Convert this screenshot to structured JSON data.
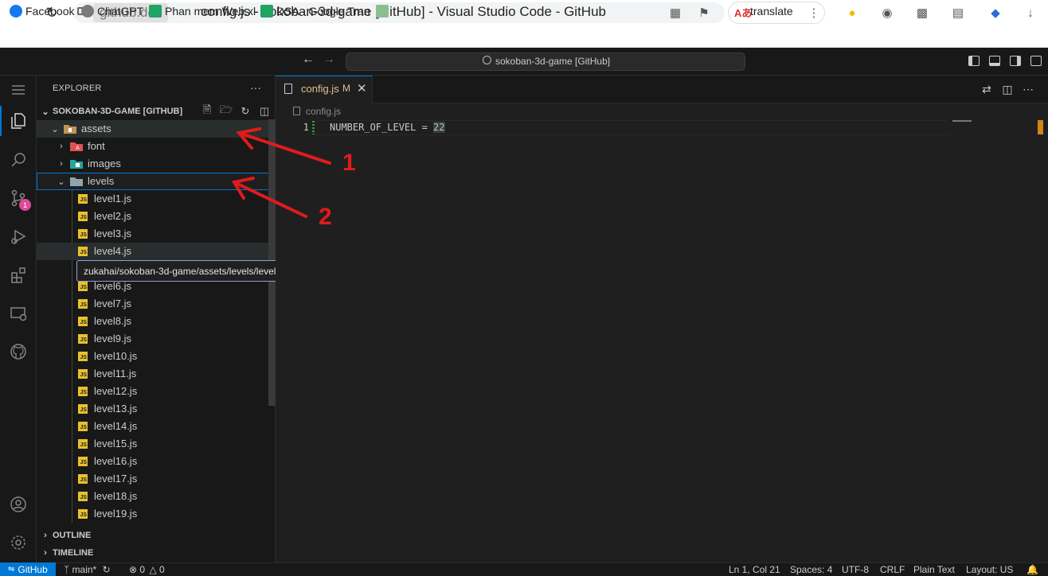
{
  "browser": {
    "domain": "github.dev",
    "page_title": "config.js - sokoban-3d-game [GitHub] - Visual Studio Code - GitHub",
    "translate_label": "translate",
    "bookmarks": [
      {
        "label": "Facebook",
        "color": "#1877f2"
      },
      {
        "label": "ChatGPT",
        "color": "#7a7a7a"
      },
      {
        "label": "Phan mem Web.xl",
        "color": "#1fa463"
      },
      {
        "label": "DSA - Google Tran",
        "color": "#1fa463"
      },
      {
        "label": "",
        "color": "#8bbf8f"
      }
    ]
  },
  "vscode": {
    "command_center": "sokoban-3d-game [GitHub]",
    "activity_badge": "1",
    "explorer": {
      "title": "EXPLORER",
      "more": "···",
      "repo_section": "SOKOBAN-3D-GAME [GITHUB]",
      "folders": {
        "assets": "assets",
        "font": "font",
        "images": "images",
        "levels": "levels"
      },
      "files": [
        "level1.js",
        "level2.js",
        "level3.js",
        "level4.js",
        "level6.js",
        "level7.js",
        "level8.js",
        "level9.js",
        "level10.js",
        "level11.js",
        "level12.js",
        "level13.js",
        "level14.js",
        "level15.js",
        "level16.js",
        "level17.js",
        "level18.js",
        "level19.js"
      ],
      "tooltip": "zukahai/sokoban-3d-game/assets/levels/level4.js",
      "outline": "OUTLINE",
      "timeline": "TIMELINE"
    },
    "editor": {
      "tab_label": "config.js",
      "tab_modified": "M",
      "breadcrumb": "config.js",
      "line_number": "1",
      "code_name": "NUMBER_OF_LEVEL = ",
      "code_value": "22"
    },
    "status": {
      "remote": "GitHub",
      "branch": "main*",
      "errors": "0",
      "warnings": "0",
      "position": "Ln 1, Col 21",
      "spaces": "Spaces: 4",
      "encoding": "UTF-8",
      "eol": "CRLF",
      "language": "Plain Text",
      "layout": "Layout: US"
    }
  },
  "annotations": [
    {
      "label": "1",
      "color": "#e01b1b"
    },
    {
      "label": "2",
      "color": "#e01b1b"
    }
  ]
}
